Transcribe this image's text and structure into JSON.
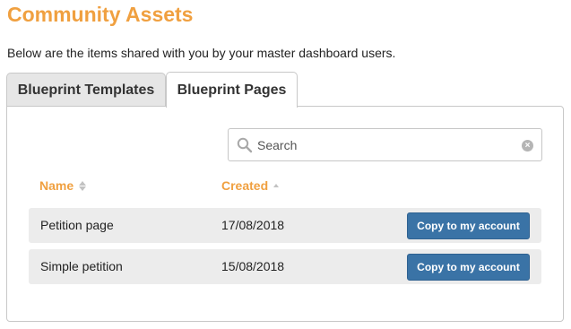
{
  "page": {
    "title": "Community Assets",
    "intro": "Below are the items shared with you by your master dashboard users."
  },
  "tabs": [
    {
      "label": "Blueprint Templates",
      "active": false
    },
    {
      "label": "Blueprint Pages",
      "active": true
    }
  ],
  "search": {
    "placeholder": "Search",
    "value": ""
  },
  "table": {
    "columns": [
      {
        "label": "Name",
        "sort": "none"
      },
      {
        "label": "Created",
        "sort": "ascending"
      }
    ],
    "rows": [
      {
        "name": "Petition page",
        "created": "17/08/2018",
        "action": "Copy to my account"
      },
      {
        "name": "Simple petition",
        "created": "15/08/2018",
        "action": "Copy to my account"
      }
    ]
  },
  "colors": {
    "accent": "#f0a040",
    "button": "#3a73a6",
    "row_bg": "#ececec"
  },
  "icons": {
    "search": "search-icon",
    "clear": "clear-icon",
    "sort": "sort-icon"
  }
}
